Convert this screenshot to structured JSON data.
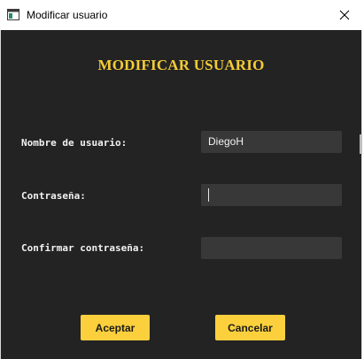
{
  "window": {
    "title": "Modificar usuario",
    "icon": "window-app-icon",
    "close_icon": "close-icon"
  },
  "form": {
    "heading": "MODIFICAR USUARIO",
    "username_label": "Nombre de usuario:",
    "username_value": "DiegoH",
    "password_label": "Contraseña:",
    "password_value": "",
    "confirm_label": "Confirmar contraseña:",
    "confirm_value": ""
  },
  "buttons": {
    "accept": "Aceptar",
    "cancel": "Cancelar"
  },
  "colors": {
    "background": "#232323",
    "accent": "#fcd03d",
    "field": "#383838"
  }
}
